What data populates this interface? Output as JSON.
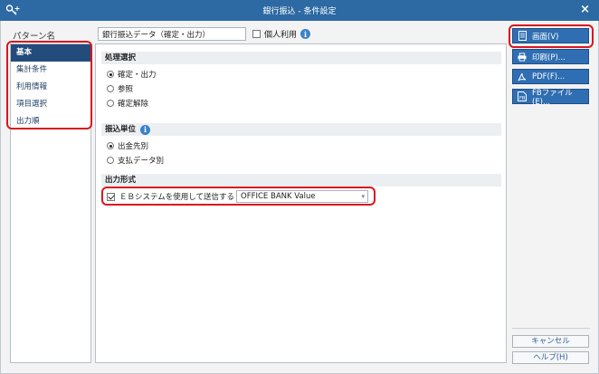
{
  "window": {
    "title": "銀行振込 - 条件設定",
    "close_label": "×"
  },
  "pattern": {
    "label": "パターン名",
    "value": "銀行振込データ（確定・出力）",
    "personal_label": "個人利用",
    "personal_checked": false
  },
  "sidebar": {
    "items": [
      {
        "label": "基本",
        "active": true
      },
      {
        "label": "集計条件",
        "active": false
      },
      {
        "label": "利用情報",
        "active": false
      },
      {
        "label": "項目選択",
        "active": false
      },
      {
        "label": "出力順",
        "active": false
      }
    ]
  },
  "processing": {
    "title": "処理選択",
    "options": [
      "確定・出力",
      "参照",
      "確定解除"
    ],
    "selected": "確定・出力"
  },
  "transfer_unit": {
    "title": "振込単位",
    "options": [
      "出金先別",
      "支払データ別"
    ],
    "selected": "出金先別"
  },
  "output_format": {
    "title": "出力形式",
    "eb_label": "ＥＢシステムを使用して送信する",
    "eb_checked": true,
    "eb_select_value": "OFFICE BANK Value"
  },
  "buttons": {
    "screen": "画面(V)",
    "print": "印刷(P)...",
    "pdf": "PDF(F)...",
    "fb_file": "FBファイル(E)...",
    "cancel": "キャンセル",
    "help": "ヘルプ(H)"
  },
  "colors": {
    "titlebar": "#2d6aa3",
    "active_sidebar": "#234c7c",
    "primary_button": "#2f6eb3",
    "highlight": "#d8171f"
  },
  "icons": [
    "key-icon",
    "close-icon",
    "info-icon",
    "screen-icon",
    "print-icon",
    "pdf-icon",
    "file-icon"
  ]
}
